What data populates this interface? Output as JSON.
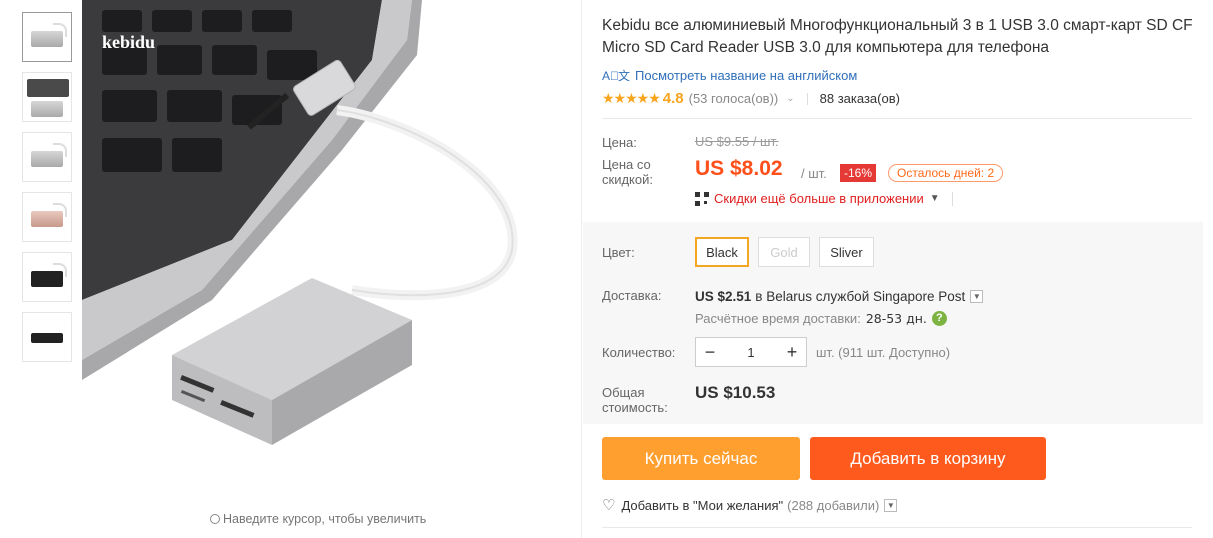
{
  "thumbnails": [
    {
      "name": "thumb-silver-cable"
    },
    {
      "name": "thumb-silver-laptop"
    },
    {
      "name": "thumb-silver-front"
    },
    {
      "name": "thumb-rose-gold"
    },
    {
      "name": "thumb-black"
    },
    {
      "name": "thumb-black-slots"
    }
  ],
  "image_area": {
    "zoom_hint": "Наведите курсор, чтобы увеличить",
    "watermark": "kebidu"
  },
  "product": {
    "title": "Kebidu все алюминиевый Многофункциональный 3 в 1 USB 3.0 смарт-карт SD CF Micro SD Card Reader USB 3.0 для компьютера для телефона",
    "translate_link": "Посмотреть название на английском",
    "rating": {
      "stars": "★★★★★",
      "value": "4.8",
      "votes": "(53 голоса(ов))",
      "orders": "88 заказа(ов)"
    }
  },
  "price": {
    "label_price": "Цена:",
    "original": "US $9.55 / шт.",
    "label_sale": "Цена со скидкой:",
    "sale": "US $8.02",
    "per_unit": "/ шт.",
    "discount": "-16%",
    "days_left": "Осталось дней: 2",
    "app_promo": "Скидки ещё больше в приложении"
  },
  "options": {
    "color_label": "Цвет:",
    "colors": [
      {
        "label": "Black",
        "state": "selected"
      },
      {
        "label": "Gold",
        "state": "disabled"
      },
      {
        "label": "Sliver",
        "state": "normal"
      }
    ],
    "shipping_label": "Доставка:",
    "shipping_price": "US $2.51",
    "shipping_text": "в Belarus службой Singapore Post",
    "delivery_time_label": "Расчётное время доставки:",
    "delivery_days": "28-53 дн.",
    "quantity_label": "Количество:",
    "quantity": "1",
    "stock": "шт. (911 шт. Доступно)",
    "total_label": "Общая стоимость:",
    "total": "US $10.53"
  },
  "actions": {
    "buy_now": "Купить сейчас",
    "add_to_cart": "Добавить в корзину",
    "wishlist": "Добавить в \"Мои желания\"",
    "wishlist_count": "(288 добавили)"
  },
  "colors": {
    "accent_orange": "#ff5a1e",
    "buy_orange": "#ff9f30",
    "price_red": "#ff4f1a",
    "discount_red": "#e53935",
    "star_yellow": "#f8a41c",
    "link_blue": "#2f6fb9"
  }
}
